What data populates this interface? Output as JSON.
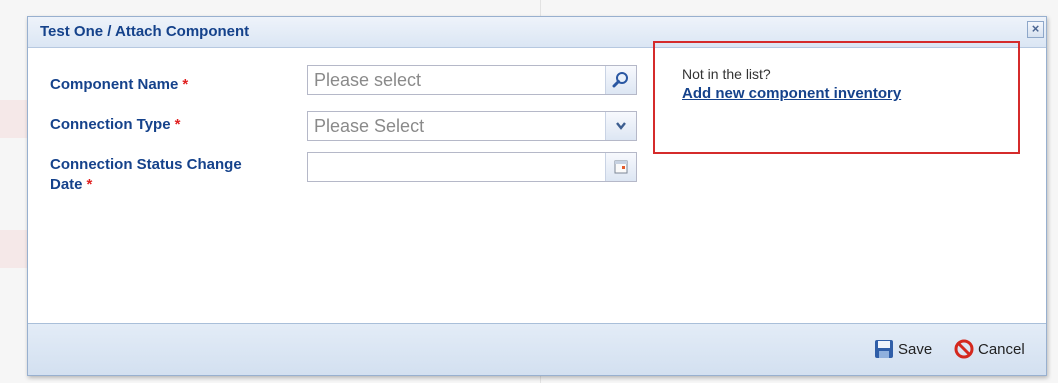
{
  "dialog": {
    "title": "Test One / Attach Component",
    "close_glyph": "×"
  },
  "form": {
    "component_name": {
      "label": "Component Name",
      "required_mark": "*",
      "placeholder": "Please select",
      "value": "",
      "trigger_icon": "search-icon"
    },
    "connection_type": {
      "label": "Connection Type",
      "required_mark": "*",
      "placeholder": "Please Select",
      "value": "",
      "trigger_icon": "chevron-down-icon"
    },
    "status_change_date": {
      "label_line1": "Connection Status Change",
      "label_line2": "Date",
      "required_mark": "*",
      "placeholder": "",
      "value": "",
      "trigger_icon": "calendar-icon"
    }
  },
  "info": {
    "text": "Not in the list?",
    "link": "Add new component inventory"
  },
  "footer": {
    "save_label": "Save",
    "cancel_label": "Cancel"
  },
  "colors": {
    "title": "#15428b",
    "required": "#e02020",
    "highlight_border": "#d52b2b"
  }
}
